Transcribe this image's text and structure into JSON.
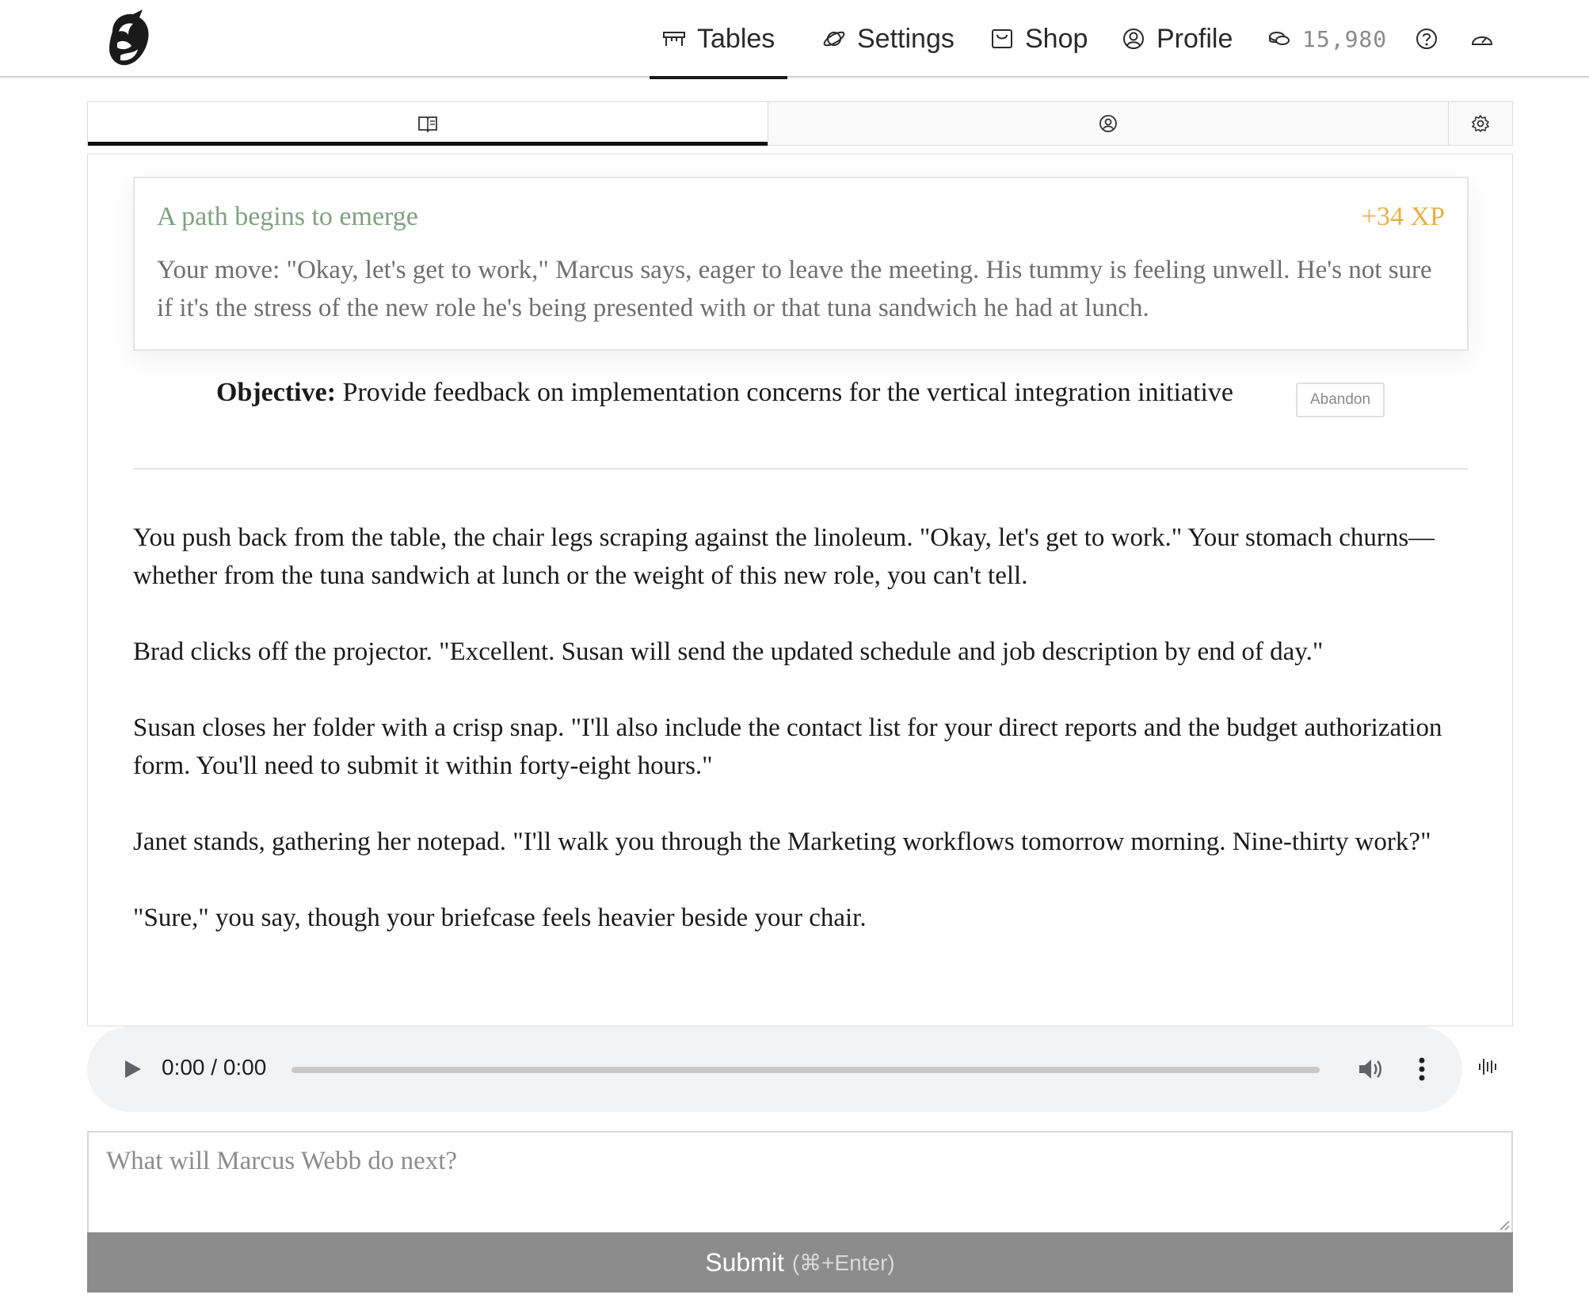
{
  "header": {
    "nav": [
      {
        "label": "Tables",
        "icon": "table-icon",
        "active": true
      },
      {
        "label": "Settings",
        "icon": "planet-icon"
      },
      {
        "label": "Shop",
        "icon": "shop-icon"
      },
      {
        "label": "Profile",
        "icon": "profile-icon"
      }
    ],
    "coins": "15,980",
    "coins_icon": "coins-icon",
    "help_icon": "help-icon",
    "dashboard_icon": "gauge-icon"
  },
  "tabs": [
    {
      "icon": "book-icon",
      "active": true
    },
    {
      "icon": "character-icon"
    },
    {
      "icon": "gear-icon"
    }
  ],
  "event_card": {
    "title": "A path begins to emerge",
    "xp": "+34 XP",
    "body": "Your move: \"Okay, let's get to work,\" Marcus says, eager to leave the meeting. His tummy is feeling unwell. He's not sure if it's the stress of the new role he's being presented with or that tuna sandwich he had at lunch."
  },
  "objective": {
    "label": "Objective:",
    "text": "Provide feedback on implementation concerns for the vertical integration initiative",
    "abandon_label": "Abandon"
  },
  "story": [
    "You push back from the table, the chair legs scraping against the linoleum. \"Okay, let's get to work.\" Your stomach churns—whether from the tuna sandwich at lunch or the weight of this new role, you can't tell.",
    "Brad clicks off the projector. \"Excellent. Susan will send the updated schedule and job description by end of day.\"",
    "Susan closes her folder with a crisp snap. \"I'll also include the contact list for your direct reports and the budget authorization form. You'll need to submit it within forty-eight hours.\"",
    "Janet stands, gathering her notepad. \"I'll walk you through the Marketing workflows tomorrow morning. Nine-thirty work?\"",
    "\"Sure,\" you say, though your briefcase feels heavier beside your chair."
  ],
  "audio": {
    "time": "0:00 / 0:00",
    "progress": 0
  },
  "input": {
    "placeholder": "What will Marcus Webb do next?"
  },
  "submit": {
    "label": "Submit",
    "hint": "(⌘+Enter)"
  },
  "colors": {
    "card_title": "#7fa27f",
    "xp": "#e6b04a",
    "submit_bg": "#8c8c8c"
  }
}
